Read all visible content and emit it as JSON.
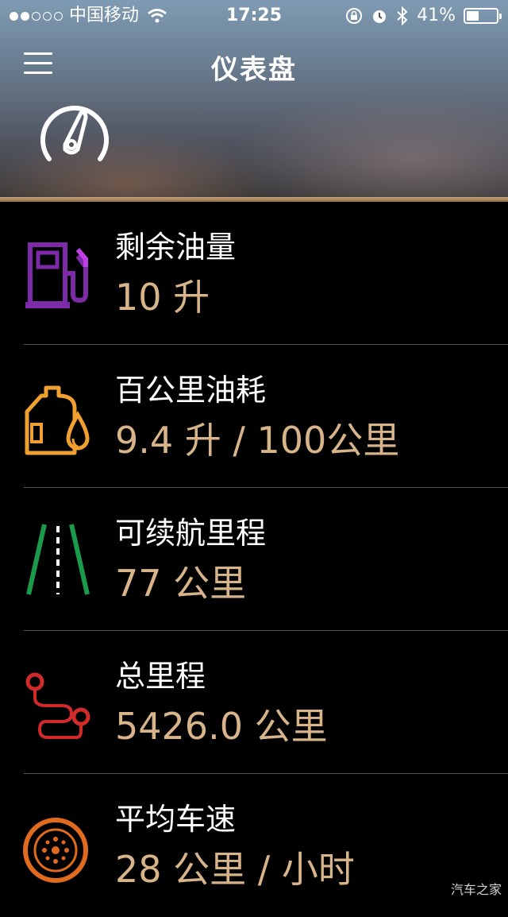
{
  "status_bar": {
    "signal_dots_filled": 2,
    "signal_dots_total": 5,
    "carrier": "中国移动",
    "time": "17:25",
    "battery_percent": "41%",
    "battery_level": 0.41
  },
  "header": {
    "title": "仪表盘"
  },
  "metrics": [
    {
      "label": "剩余油量",
      "value": "10 升",
      "icon": "fuel-pump-icon",
      "color": "#7d2aa8"
    },
    {
      "label": "百公里油耗",
      "value": "9.4 升 / 100公里",
      "icon": "oil-can-icon",
      "color": "#f0a030"
    },
    {
      "label": "可续航里程",
      "value": "77 公里",
      "icon": "road-icon",
      "color": "#1a9a4a"
    },
    {
      "label": "总里程",
      "value": "5426.0 公里",
      "icon": "route-icon",
      "color": "#d02a2a"
    },
    {
      "label": "平均车速",
      "value": "28 公里 / 小时",
      "icon": "tire-icon",
      "color": "#e06a1e"
    }
  ],
  "colors": {
    "value_text": "#d7b48a",
    "accent_line": "#c9a57a"
  },
  "watermark": "汽车之家"
}
